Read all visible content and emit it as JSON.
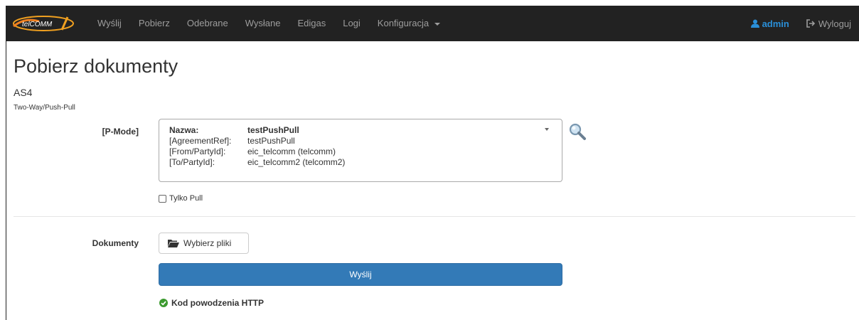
{
  "navbar": {
    "logo_text": "telCOMM",
    "items": [
      {
        "label": "Wyślij"
      },
      {
        "label": "Pobierz"
      },
      {
        "label": "Odebrane"
      },
      {
        "label": "Wysłane"
      },
      {
        "label": "Edigas"
      },
      {
        "label": "Logi"
      },
      {
        "label": "Konfiguracja"
      }
    ],
    "user": "admin",
    "logout": "Wyloguj",
    "accent_color": "#2a8fd8"
  },
  "page": {
    "title": "Pobierz dokumenty",
    "subtitle": "AS4",
    "mode": "Two-Way/Push-Pull"
  },
  "form": {
    "pmode_label": "[P-Mode]",
    "pmode": {
      "rows": [
        {
          "key": "Nazwa:",
          "value": "testPushPull"
        },
        {
          "key": "[AgreementRef]:",
          "value": "testPushPull"
        },
        {
          "key": "[From/PartyId]:",
          "value": "eic_telcomm (telcomm)"
        },
        {
          "key": "[To/PartyId]:",
          "value": "eic_telcomm2 (telcomm2)"
        }
      ]
    },
    "only_pull_label": "Tylko Pull",
    "only_pull_checked": false,
    "documents_label": "Dokumenty",
    "choose_files_label": "Wybierz pliki",
    "send_label": "Wyślij",
    "send_color": "#337ab7"
  },
  "status": {
    "text": "Kod powodzenia HTTP",
    "icon": "check-circle-icon",
    "color": "#3c9a2f"
  }
}
